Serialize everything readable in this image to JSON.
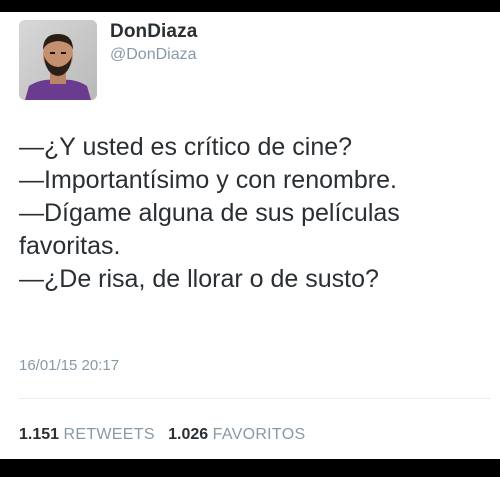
{
  "tweet": {
    "author": {
      "display_name": "DonDiaza",
      "handle": "@DonDiaza",
      "avatar_icon": "profile-photo"
    },
    "lines": [
      "—¿Y usted es crítico de cine?",
      "—Importantísimo y con renombre.",
      "—Dígame alguna de sus películas",
      "favoritas.",
      "—¿De risa, de llorar o de susto?"
    ],
    "timestamp": "16/01/15 20:17",
    "stats": {
      "retweets_count": "1.151",
      "retweets_label": "RETWEETS",
      "favorites_count": "1.026",
      "favorites_label": "FAVORITOS"
    }
  },
  "colors": {
    "text_primary": "#292f33",
    "text_secondary": "#8899a6",
    "background": "#ffffff",
    "frame": "#000000"
  }
}
